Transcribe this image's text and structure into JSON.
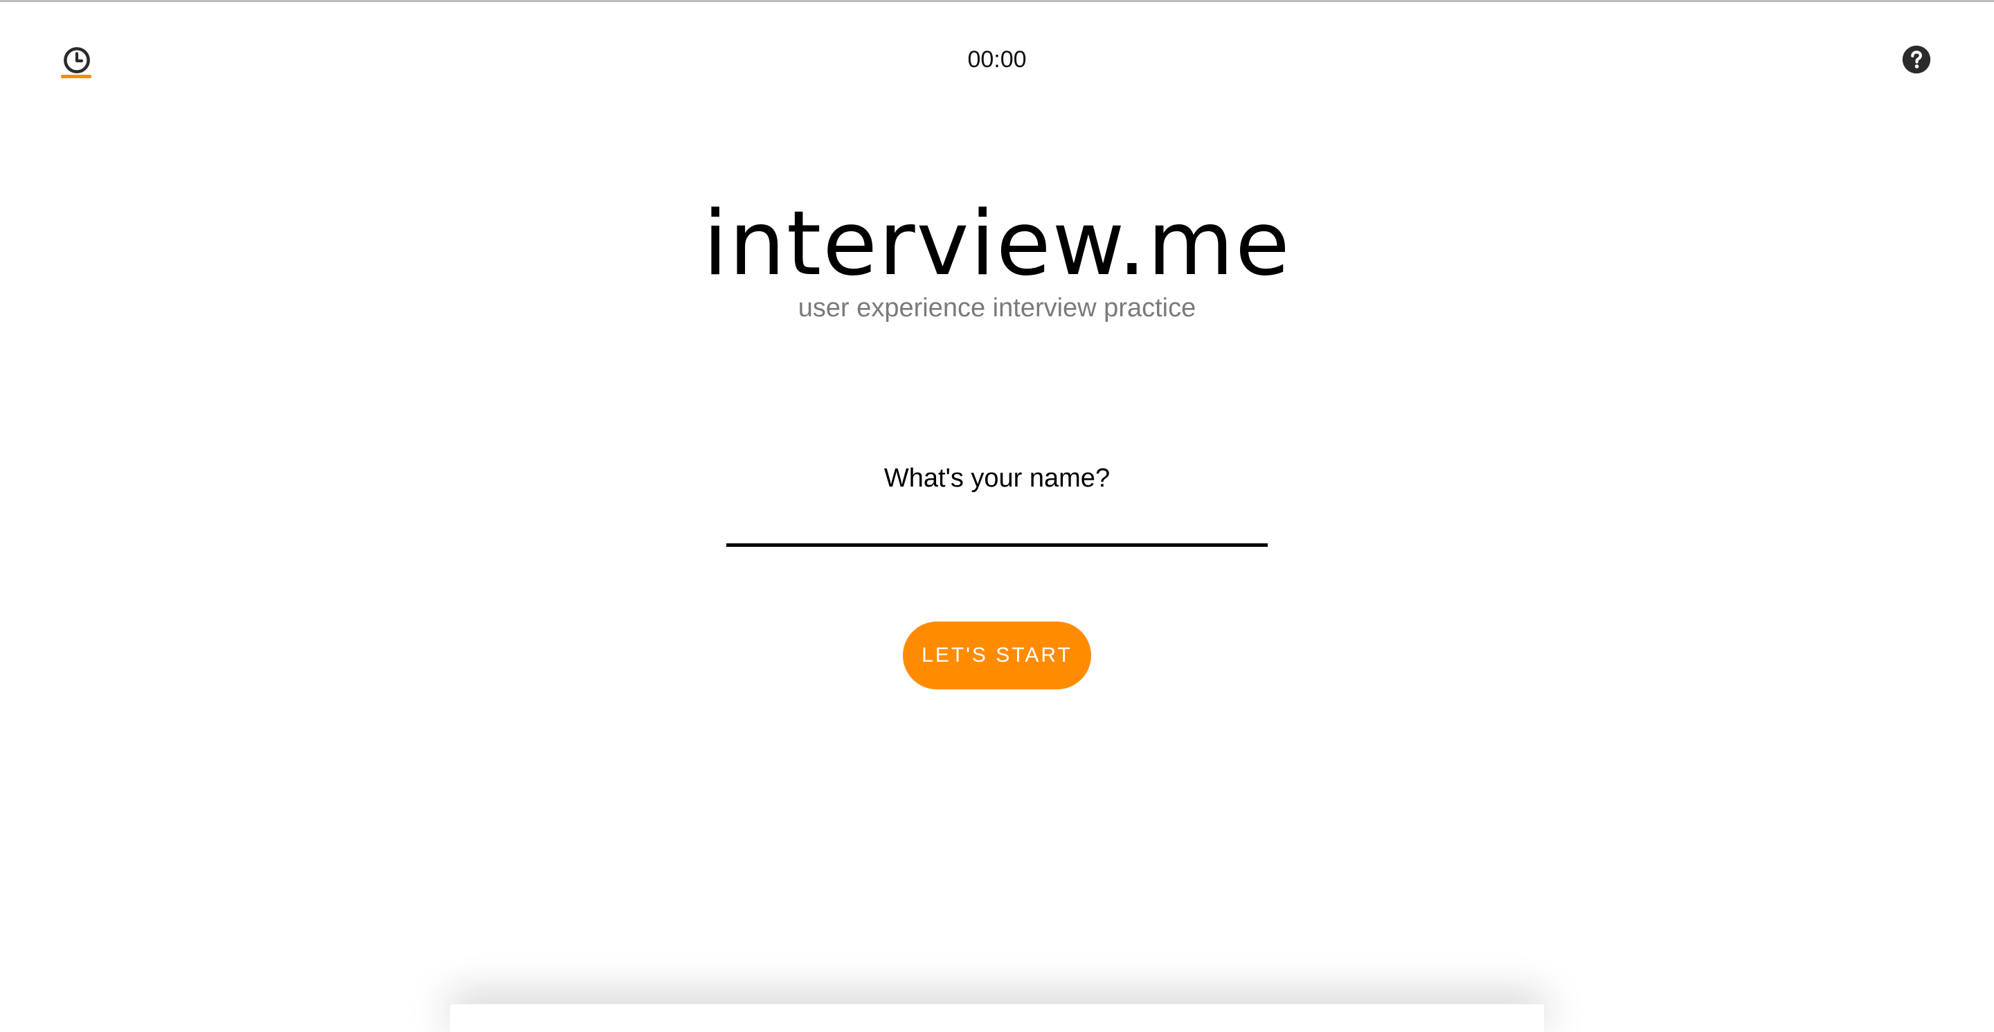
{
  "colors": {
    "accent": "#ff8c00",
    "icon": "#2b2b2b",
    "tagline": "#7a7a7a"
  },
  "topbar": {
    "timer_icon": "clock-icon",
    "timer_display": "00:00",
    "help_icon": "question-circle-icon"
  },
  "brand": {
    "title": "interview.me",
    "tagline": "user experience interview practice"
  },
  "form": {
    "question": "What's your name?",
    "name_value": "",
    "name_placeholder": "",
    "start_label": "LET'S START"
  }
}
